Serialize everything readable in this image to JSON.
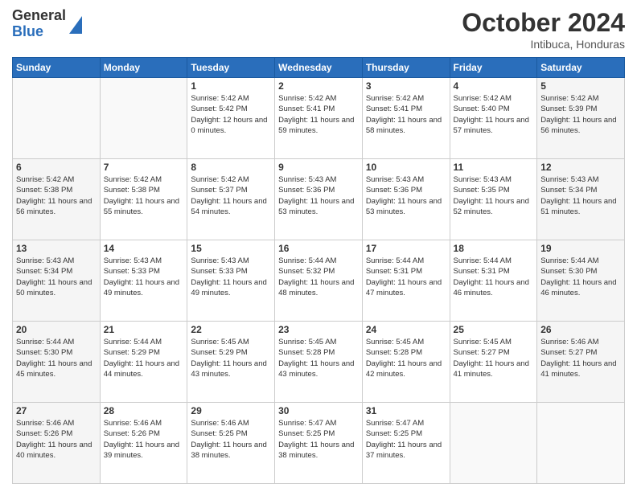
{
  "header": {
    "logo_general": "General",
    "logo_blue": "Blue",
    "month_title": "October 2024",
    "subtitle": "Intibuca, Honduras"
  },
  "days_of_week": [
    "Sunday",
    "Monday",
    "Tuesday",
    "Wednesday",
    "Thursday",
    "Friday",
    "Saturday"
  ],
  "weeks": [
    [
      {
        "day": "",
        "sunrise": "",
        "sunset": "",
        "daylight": "",
        "empty": true
      },
      {
        "day": "",
        "sunrise": "",
        "sunset": "",
        "daylight": "",
        "empty": true
      },
      {
        "day": "1",
        "sunrise": "Sunrise: 5:42 AM",
        "sunset": "Sunset: 5:42 PM",
        "daylight": "Daylight: 12 hours and 0 minutes."
      },
      {
        "day": "2",
        "sunrise": "Sunrise: 5:42 AM",
        "sunset": "Sunset: 5:41 PM",
        "daylight": "Daylight: 11 hours and 59 minutes."
      },
      {
        "day": "3",
        "sunrise": "Sunrise: 5:42 AM",
        "sunset": "Sunset: 5:41 PM",
        "daylight": "Daylight: 11 hours and 58 minutes."
      },
      {
        "day": "4",
        "sunrise": "Sunrise: 5:42 AM",
        "sunset": "Sunset: 5:40 PM",
        "daylight": "Daylight: 11 hours and 57 minutes."
      },
      {
        "day": "5",
        "sunrise": "Sunrise: 5:42 AM",
        "sunset": "Sunset: 5:39 PM",
        "daylight": "Daylight: 11 hours and 56 minutes."
      }
    ],
    [
      {
        "day": "6",
        "sunrise": "Sunrise: 5:42 AM",
        "sunset": "Sunset: 5:38 PM",
        "daylight": "Daylight: 11 hours and 56 minutes."
      },
      {
        "day": "7",
        "sunrise": "Sunrise: 5:42 AM",
        "sunset": "Sunset: 5:38 PM",
        "daylight": "Daylight: 11 hours and 55 minutes."
      },
      {
        "day": "8",
        "sunrise": "Sunrise: 5:42 AM",
        "sunset": "Sunset: 5:37 PM",
        "daylight": "Daylight: 11 hours and 54 minutes."
      },
      {
        "day": "9",
        "sunrise": "Sunrise: 5:43 AM",
        "sunset": "Sunset: 5:36 PM",
        "daylight": "Daylight: 11 hours and 53 minutes."
      },
      {
        "day": "10",
        "sunrise": "Sunrise: 5:43 AM",
        "sunset": "Sunset: 5:36 PM",
        "daylight": "Daylight: 11 hours and 53 minutes."
      },
      {
        "day": "11",
        "sunrise": "Sunrise: 5:43 AM",
        "sunset": "Sunset: 5:35 PM",
        "daylight": "Daylight: 11 hours and 52 minutes."
      },
      {
        "day": "12",
        "sunrise": "Sunrise: 5:43 AM",
        "sunset": "Sunset: 5:34 PM",
        "daylight": "Daylight: 11 hours and 51 minutes."
      }
    ],
    [
      {
        "day": "13",
        "sunrise": "Sunrise: 5:43 AM",
        "sunset": "Sunset: 5:34 PM",
        "daylight": "Daylight: 11 hours and 50 minutes."
      },
      {
        "day": "14",
        "sunrise": "Sunrise: 5:43 AM",
        "sunset": "Sunset: 5:33 PM",
        "daylight": "Daylight: 11 hours and 49 minutes."
      },
      {
        "day": "15",
        "sunrise": "Sunrise: 5:43 AM",
        "sunset": "Sunset: 5:33 PM",
        "daylight": "Daylight: 11 hours and 49 minutes."
      },
      {
        "day": "16",
        "sunrise": "Sunrise: 5:44 AM",
        "sunset": "Sunset: 5:32 PM",
        "daylight": "Daylight: 11 hours and 48 minutes."
      },
      {
        "day": "17",
        "sunrise": "Sunrise: 5:44 AM",
        "sunset": "Sunset: 5:31 PM",
        "daylight": "Daylight: 11 hours and 47 minutes."
      },
      {
        "day": "18",
        "sunrise": "Sunrise: 5:44 AM",
        "sunset": "Sunset: 5:31 PM",
        "daylight": "Daylight: 11 hours and 46 minutes."
      },
      {
        "day": "19",
        "sunrise": "Sunrise: 5:44 AM",
        "sunset": "Sunset: 5:30 PM",
        "daylight": "Daylight: 11 hours and 46 minutes."
      }
    ],
    [
      {
        "day": "20",
        "sunrise": "Sunrise: 5:44 AM",
        "sunset": "Sunset: 5:30 PM",
        "daylight": "Daylight: 11 hours and 45 minutes."
      },
      {
        "day": "21",
        "sunrise": "Sunrise: 5:44 AM",
        "sunset": "Sunset: 5:29 PM",
        "daylight": "Daylight: 11 hours and 44 minutes."
      },
      {
        "day": "22",
        "sunrise": "Sunrise: 5:45 AM",
        "sunset": "Sunset: 5:29 PM",
        "daylight": "Daylight: 11 hours and 43 minutes."
      },
      {
        "day": "23",
        "sunrise": "Sunrise: 5:45 AM",
        "sunset": "Sunset: 5:28 PM",
        "daylight": "Daylight: 11 hours and 43 minutes."
      },
      {
        "day": "24",
        "sunrise": "Sunrise: 5:45 AM",
        "sunset": "Sunset: 5:28 PM",
        "daylight": "Daylight: 11 hours and 42 minutes."
      },
      {
        "day": "25",
        "sunrise": "Sunrise: 5:45 AM",
        "sunset": "Sunset: 5:27 PM",
        "daylight": "Daylight: 11 hours and 41 minutes."
      },
      {
        "day": "26",
        "sunrise": "Sunrise: 5:46 AM",
        "sunset": "Sunset: 5:27 PM",
        "daylight": "Daylight: 11 hours and 41 minutes."
      }
    ],
    [
      {
        "day": "27",
        "sunrise": "Sunrise: 5:46 AM",
        "sunset": "Sunset: 5:26 PM",
        "daylight": "Daylight: 11 hours and 40 minutes."
      },
      {
        "day": "28",
        "sunrise": "Sunrise: 5:46 AM",
        "sunset": "Sunset: 5:26 PM",
        "daylight": "Daylight: 11 hours and 39 minutes."
      },
      {
        "day": "29",
        "sunrise": "Sunrise: 5:46 AM",
        "sunset": "Sunset: 5:25 PM",
        "daylight": "Daylight: 11 hours and 38 minutes."
      },
      {
        "day": "30",
        "sunrise": "Sunrise: 5:47 AM",
        "sunset": "Sunset: 5:25 PM",
        "daylight": "Daylight: 11 hours and 38 minutes."
      },
      {
        "day": "31",
        "sunrise": "Sunrise: 5:47 AM",
        "sunset": "Sunset: 5:25 PM",
        "daylight": "Daylight: 11 hours and 37 minutes."
      },
      {
        "day": "",
        "sunrise": "",
        "sunset": "",
        "daylight": "",
        "empty": true
      },
      {
        "day": "",
        "sunrise": "",
        "sunset": "",
        "daylight": "",
        "empty": true
      }
    ]
  ]
}
